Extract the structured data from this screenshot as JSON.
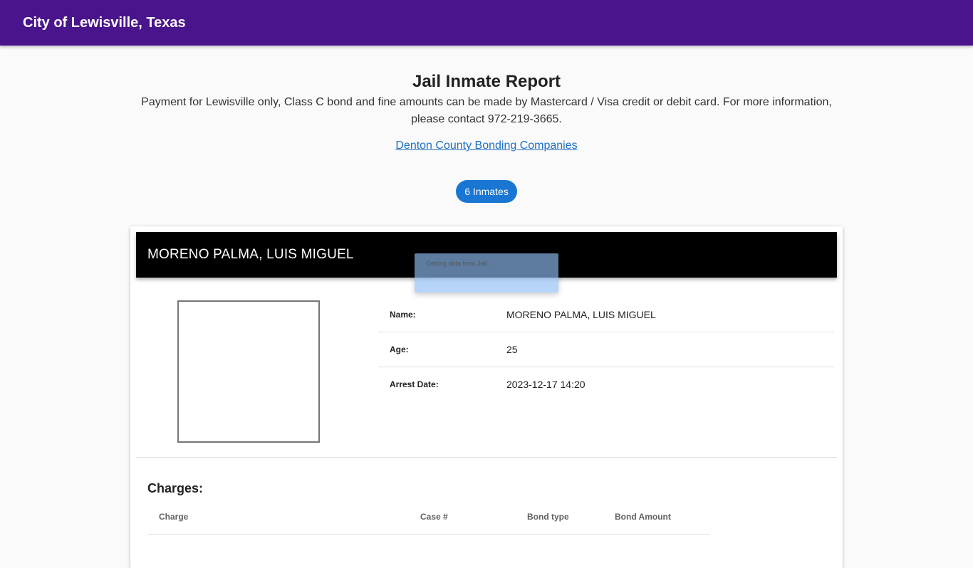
{
  "app": {
    "title": "City of Lewisville, Texas"
  },
  "intro": {
    "heading": "Jail Inmate Report",
    "description": "Payment for Lewisville only, Class C bond and fine amounts can be made by Mastercard / Visa credit or debit card. For more information, please contact 972-219-3665.",
    "link_label": "Denton County Bonding Companies"
  },
  "inmate_count": "6 Inmates",
  "loading": {
    "message": "Getting data from Jail..."
  },
  "inmate": {
    "header_name": "MORENO PALMA, LUIS MIGUEL",
    "details": [
      {
        "label": "Name:",
        "value": "MORENO PALMA, LUIS MIGUEL"
      },
      {
        "label": "Age:",
        "value": "25"
      },
      {
        "label": "Arrest Date:",
        "value": "2023-12-17 14:20"
      }
    ],
    "charges_title": "Charges:",
    "charges_columns": [
      "Charge",
      "Case #",
      "Bond type",
      "Bond Amount"
    ]
  },
  "colors": {
    "topbar": "#4a148c",
    "chip": "#1976d2",
    "link": "#1e6fc4",
    "card_header": "#000000"
  }
}
